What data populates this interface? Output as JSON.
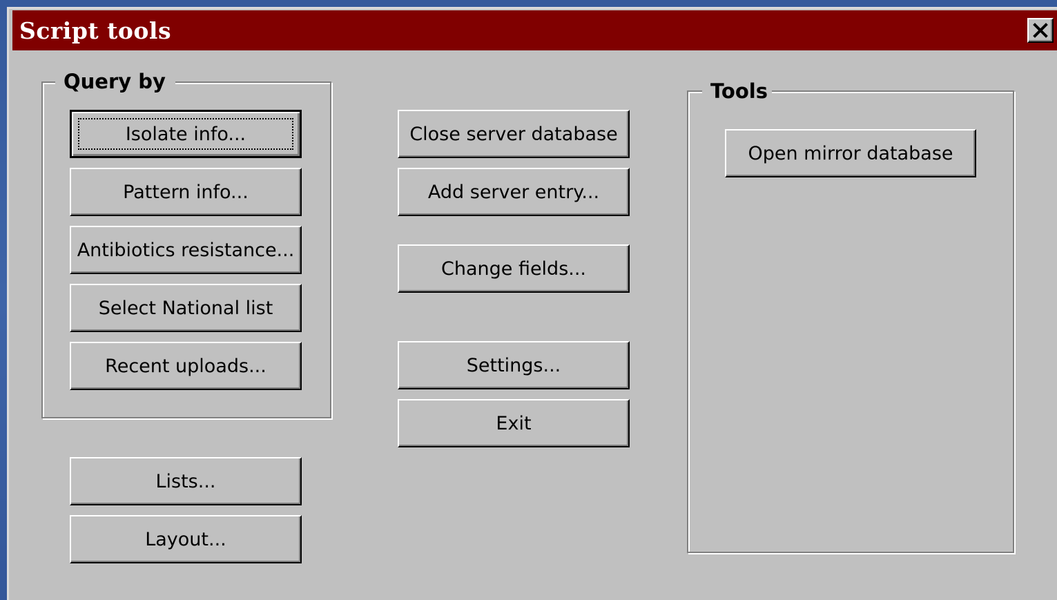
{
  "window": {
    "title": "Script tools",
    "close_icon": "close-icon"
  },
  "query_by": {
    "label": "Query by",
    "buttons": [
      "Isolate info...",
      "Pattern info...",
      "Antibiotics resistance...",
      "Select National list",
      "Recent uploads..."
    ]
  },
  "left_extra": {
    "lists_label": "Lists...",
    "layout_label": "Layout..."
  },
  "middle": {
    "close_server_label": "Close server database",
    "add_server_label": "Add server entry...",
    "change_fields_label": "Change fields...",
    "settings_label": "Settings...",
    "exit_label": "Exit"
  },
  "tools": {
    "label": "Tools",
    "open_mirror_label": "Open mirror database"
  },
  "colors": {
    "titlebar": "#800000",
    "face": "#c0c0c0",
    "desktop": "#3e64a8"
  }
}
